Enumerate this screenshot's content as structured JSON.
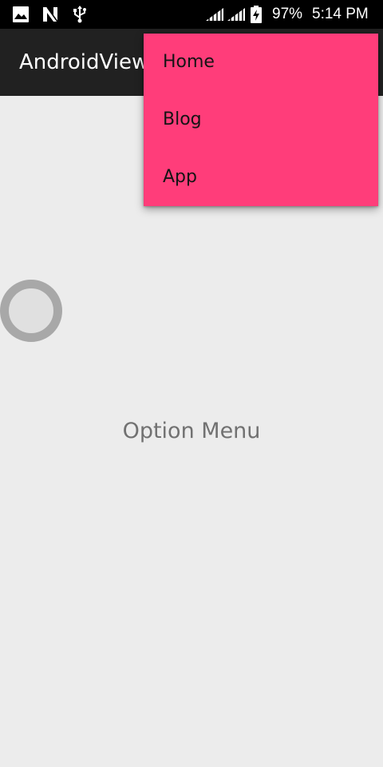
{
  "status_bar": {
    "battery_percent": "97%",
    "time": "5:14 PM",
    "left_icons": [
      "image-icon",
      "n-icon",
      "usb-icon"
    ],
    "right_icons": [
      "signal-icon",
      "signal-icon",
      "battery-charging-icon"
    ]
  },
  "app_bar": {
    "title": "AndroidView"
  },
  "overflow_menu": {
    "items": [
      {
        "label": "Home"
      },
      {
        "label": "Blog"
      },
      {
        "label": "App"
      }
    ]
  },
  "main": {
    "label": "Option Menu"
  },
  "colors": {
    "status_bar": "#000000",
    "app_bar": "#212121",
    "menu_background": "#ff3d7a",
    "content_background": "#ececec",
    "label_text": "#717171"
  }
}
